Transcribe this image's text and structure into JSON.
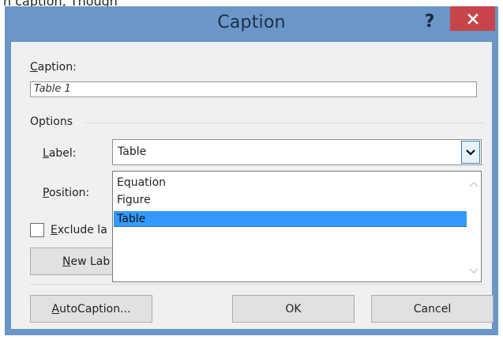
{
  "backdrop": {
    "partial_text": "n caption, Though"
  },
  "titlebar": {
    "title": "Caption",
    "help_label": "?",
    "close_label": "✕"
  },
  "caption_field": {
    "label_pre": "",
    "label_mn": "C",
    "label_post": "aption:",
    "value": "Table 1"
  },
  "options_group": {
    "title": "Options"
  },
  "label_field": {
    "label_mn": "L",
    "label_post": "abel:",
    "selected": "Table",
    "options": [
      "Equation",
      "Figure",
      "Table"
    ]
  },
  "position_field": {
    "label_mn": "P",
    "label_post": "osition:"
  },
  "exclude_checkbox": {
    "label_mn": "E",
    "label_post": "xclude la"
  },
  "new_label_button": {
    "label_mn": "N",
    "label_post": "ew Lab"
  },
  "buttons": {
    "autocaption_mn": "A",
    "autocaption_post": "utoCaption...",
    "ok": "OK",
    "cancel": "Cancel"
  },
  "colors": {
    "frame": "#6a96c8",
    "close": "#c7454a",
    "highlight": "#3399ff"
  }
}
